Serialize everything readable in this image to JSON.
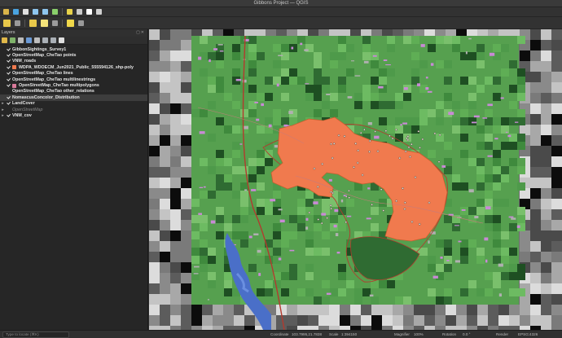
{
  "window": {
    "title": "Gibbons Project — QGIS"
  },
  "layers_panel": {
    "title": "Layers",
    "layers": [
      {
        "name": "GibbonSightings_Survey1",
        "checked": true,
        "symbol": "",
        "dim": false
      },
      {
        "name": "OpenStreetMap_CheTao points",
        "checked": true,
        "symbol": "",
        "dim": false
      },
      {
        "name": "VNM_roads",
        "checked": true,
        "symbol": "",
        "dim": false
      },
      {
        "name": "WDPA_WDOECM_Jun2021_Public_555594126_shp-poly",
        "checked": true,
        "symbol": "#f07a4e",
        "dim": false
      },
      {
        "name": "OpenStreetMap_CheTao lines",
        "checked": true,
        "symbol": "",
        "dim": false
      },
      {
        "name": "OpenStreetMap_CheTao multilinestrings",
        "checked": true,
        "symbol": "",
        "dim": false
      },
      {
        "name": "OpenStreetMap_CheTao multipolygons",
        "checked": true,
        "symbol": "#d97a9a",
        "dim": false
      },
      {
        "name": "OpenStreetMap_CheTao other_relations",
        "checked": false,
        "symbol": "",
        "dim": false
      },
      {
        "name": "NomascusConcolor_Distribution",
        "checked": true,
        "symbol": "",
        "dim": false,
        "selected": true
      },
      {
        "name": "LandCover",
        "checked": true,
        "symbol": "",
        "dim": false,
        "expandable": true
      },
      {
        "name": "OpenStreetMap",
        "checked": false,
        "symbol": "",
        "dim": true,
        "expandable": true
      },
      {
        "name": "VNM_cov",
        "checked": true,
        "symbol": "",
        "dim": false,
        "expandable": true
      }
    ]
  },
  "status": {
    "locate_placeholder": "Type to locate (⌘K)",
    "coordinate_label": "Coordinate",
    "coordinate_value": "103.7995,21.7838",
    "scale_label": "Scale",
    "scale_value": "1:394150",
    "magnifier_label": "Magnifier",
    "magnifier_value": "100%",
    "rotation_label": "Rotation",
    "rotation_value": "0.0 °",
    "render_label": "Render",
    "crs": "EPSG:4326"
  },
  "colors": {
    "protected_area": "#f07a4e",
    "distribution_outline": "#c0392b",
    "landcover_green": "#4e9a4a",
    "river": "#4a6fc8"
  }
}
